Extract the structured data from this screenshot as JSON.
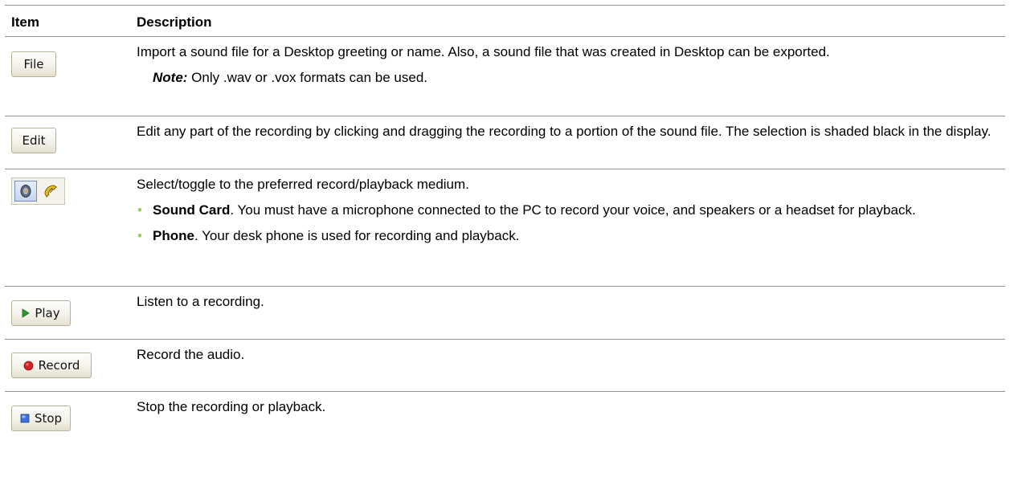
{
  "table": {
    "header": {
      "item": "Item",
      "description": "Description"
    },
    "rows": {
      "file": {
        "button_label": "File",
        "description": "Import a sound file for a Desktop greeting or name. Also, a sound file that was created in Desktop can be exported.",
        "note_label": "Note:",
        "note_text": " Only .wav or .vox formats can be used."
      },
      "edit": {
        "button_label": "Edit",
        "description": "Edit any part of the recording by clicking and dragging the recording to a portion of the sound file. The selection is shaded black in the display."
      },
      "medium": {
        "icons": [
          "speaker-icon",
          "phone-icon"
        ],
        "description": "Select/toggle to the preferred record/playback medium.",
        "bullets": [
          {
            "term": "Sound Card",
            "text": ". You must have a microphone connected to the PC to record your voice, and speakers or a headset for playback."
          },
          {
            "term": "Phone",
            "text": ". Your desk phone is used for recording and playback."
          }
        ]
      },
      "play": {
        "button_label": "Play",
        "icon": "play-icon",
        "description": "Listen to a recording."
      },
      "record": {
        "button_label": "Record",
        "icon": "record-icon",
        "description": "Record the audio."
      },
      "stop": {
        "button_label": "Stop",
        "icon": "stop-icon",
        "description": "Stop the recording or playback."
      }
    }
  },
  "colors": {
    "rule": "#8f8f8f",
    "bullet": "#9bcc5a",
    "play_green": "#2e9a2e",
    "record_red": "#d42424",
    "stop_blue": "#3f6fd8"
  }
}
